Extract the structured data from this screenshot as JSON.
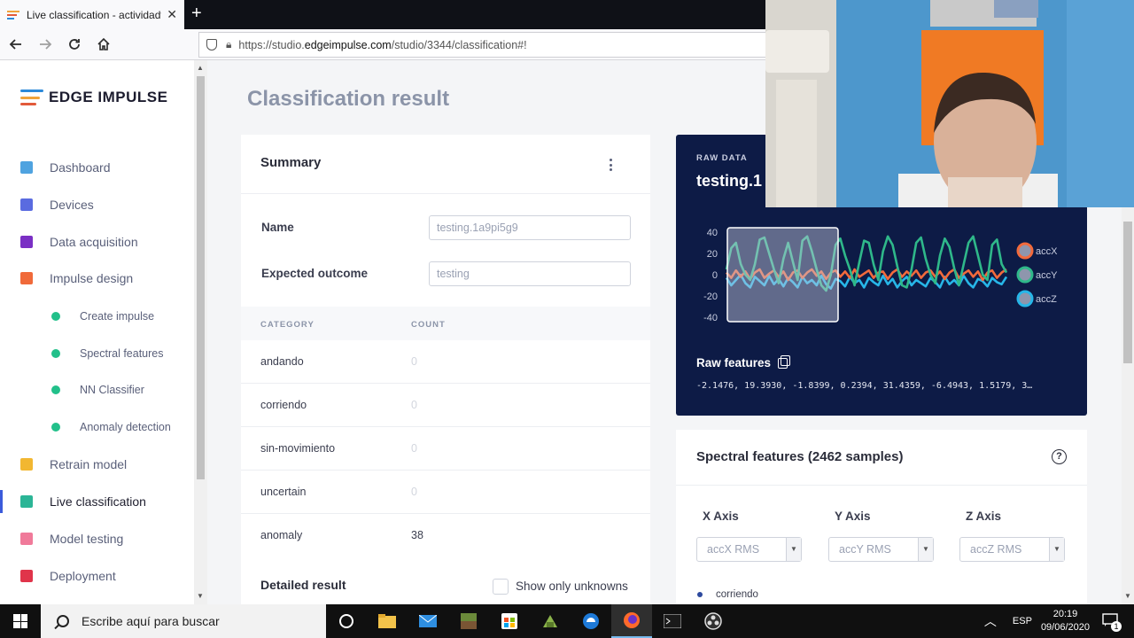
{
  "browser": {
    "tab_title": "Live classification - actividadfis",
    "close_glyph": "✕",
    "new_tab_glyph": "+",
    "url_prefix": "https://studio.",
    "url_host": "edgeimpulse.com",
    "url_path": "/studio/3344/classification#!"
  },
  "sidebar": {
    "logo_text": "EDGE IMPULSE",
    "items": [
      {
        "label": "Dashboard",
        "icon": "monitor-icon",
        "color": "#4fa3e0"
      },
      {
        "label": "Devices",
        "icon": "chip-icon",
        "color": "#5a6be0"
      },
      {
        "label": "Data acquisition",
        "icon": "database-icon",
        "color": "#7a2fc4"
      },
      {
        "label": "Impulse design",
        "icon": "pulse-icon",
        "color": "#f06a3a"
      },
      {
        "label": "Create impulse",
        "sub": true
      },
      {
        "label": "Spectral features",
        "sub": true
      },
      {
        "label": "NN Classifier",
        "sub": true
      },
      {
        "label": "Anomaly detection",
        "sub": true
      },
      {
        "label": "Retrain model",
        "icon": "shuffle-icon",
        "color": "#f2b731"
      },
      {
        "label": "Live classification",
        "icon": "live-icon",
        "color": "#2bb596",
        "active": true
      },
      {
        "label": "Model testing",
        "icon": "clipboard-icon",
        "color": "#f07a9a"
      },
      {
        "label": "Deployment",
        "icon": "box-icon",
        "color": "#e0344a"
      }
    ]
  },
  "page": {
    "title": "Classification result"
  },
  "summary": {
    "title": "Summary",
    "name_label": "Name",
    "name_value": "testing.1a9pi5g9",
    "outcome_label": "Expected outcome",
    "outcome_value": "testing",
    "col_category": "CATEGORY",
    "col_count": "COUNT",
    "rows": [
      {
        "category": "andando",
        "count": "0"
      },
      {
        "category": "corriendo",
        "count": "0"
      },
      {
        "category": "sin-movimiento",
        "count": "0"
      },
      {
        "category": "uncertain",
        "count": "0"
      },
      {
        "category": "anomaly",
        "count": "38"
      }
    ],
    "detailed_title": "Detailed result",
    "show_unknowns_label": "Show only unknowns"
  },
  "raw": {
    "label": "RAW DATA",
    "sample_name": "testing.1",
    "features_title": "Raw features",
    "features_values": "-2.1476, 19.3930, -1.8399, 0.2394, 31.4359, -6.4943, 1.5179, 3…",
    "legend": [
      "accX",
      "accY",
      "accZ"
    ],
    "colors": {
      "accX": "#f26a3c",
      "accY": "#2fb88a",
      "accZ": "#27b6e8"
    }
  },
  "chart_data": {
    "type": "line",
    "yticks": [
      "40",
      "20",
      "0",
      "-20",
      "-40"
    ],
    "ylim": [
      -40,
      40
    ],
    "series": [
      {
        "name": "accX",
        "values": [
          2,
          -3,
          4,
          -2,
          3,
          -4,
          2,
          5,
          -3,
          1,
          4,
          -2,
          3,
          -5,
          2,
          4,
          -3,
          2,
          5,
          -1,
          3,
          -4,
          2,
          4,
          -2,
          3,
          -3,
          5,
          -2,
          1,
          4,
          -3,
          2,
          3,
          -4,
          2,
          5,
          -2,
          3,
          -1,
          4,
          -3,
          2,
          4,
          -2,
          3,
          -4,
          2,
          5,
          -3,
          1,
          4,
          -2,
          3,
          -5,
          2,
          4,
          -3,
          2,
          5
        ]
      },
      {
        "name": "accY",
        "values": [
          5,
          25,
          30,
          10,
          0,
          -5,
          10,
          33,
          35,
          20,
          5,
          -8,
          15,
          30,
          12,
          -5,
          32,
          36,
          22,
          5,
          -10,
          -15,
          0,
          28,
          34,
          18,
          5,
          -10,
          12,
          32,
          30,
          10,
          -5,
          22,
          36,
          28,
          8,
          -10,
          -12,
          5,
          30,
          35,
          15,
          0,
          -8,
          18,
          34,
          26,
          6,
          -10,
          10,
          30,
          36,
          18,
          0,
          -5,
          28,
          33,
          10,
          2
        ]
      },
      {
        "name": "accZ",
        "values": [
          -3,
          -10,
          -5,
          0,
          -8,
          -12,
          -2,
          -6,
          -10,
          -1,
          -9,
          -4,
          -11,
          -3,
          -7,
          -12,
          -2,
          -8,
          -5,
          -10,
          -1,
          -9,
          -13,
          -4,
          -6,
          -11,
          -2,
          -8,
          -5,
          -12,
          -3,
          -7,
          -10,
          -1,
          -9,
          -4,
          -12,
          -6,
          -2,
          -10,
          -5,
          -8,
          -11,
          -3,
          -7,
          -12,
          -2,
          -9,
          -5,
          -10,
          -1,
          -8,
          -12,
          -4,
          -6,
          -11,
          -3,
          -7,
          -9,
          -2
        ]
      }
    ]
  },
  "spectral": {
    "title": "Spectral features (2462 samples)",
    "x_label": "X Axis",
    "y_label": "Y Axis",
    "z_label": "Z Axis",
    "x_value": "accX RMS",
    "y_value": "accY RMS",
    "z_value": "accZ RMS",
    "legend_first": "corriendo"
  },
  "taskbar": {
    "search_placeholder": "Escribe aquí para buscar",
    "lang": "ESP",
    "time": "20:19",
    "date": "09/06/2020",
    "notification_count": "1"
  }
}
